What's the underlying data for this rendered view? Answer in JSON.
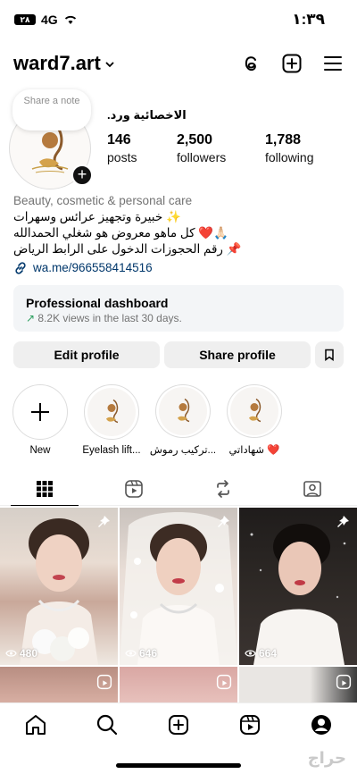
{
  "status": {
    "battery": "٢٨",
    "network": "4G",
    "time": "١:٣٩"
  },
  "header": {
    "username": "ward7.art",
    "icons": [
      "threads-icon",
      "create-icon",
      "menu-icon"
    ]
  },
  "profile": {
    "note_placeholder": "Share a note",
    "display_name": "الاخصائية ورد.",
    "stats": [
      {
        "value": "146",
        "label": "posts"
      },
      {
        "value": "2,500",
        "label": "followers"
      },
      {
        "value": "1,788",
        "label": "following"
      }
    ],
    "category": "Beauty, cosmetic & personal care",
    "bio_lines": [
      "خبيرة وتجهيز عرائس وسهرات ✨",
      "كل ماهو معروض هو شغلي الحمدالله ❤️🙏🏻",
      "رقم الحجوزات الدخول على الرابط الرياض 📌"
    ],
    "link": "wa.me/966558414516"
  },
  "dashboard": {
    "title": "Professional dashboard",
    "subtitle": "8.2K views in the last 30 days."
  },
  "actions": {
    "edit": "Edit profile",
    "share": "Share profile"
  },
  "highlights": [
    {
      "label": "New"
    },
    {
      "label": "Eyelash lift..."
    },
    {
      "label": "تركيب رموش..."
    },
    {
      "label": "شهاداتي ❤️"
    }
  ],
  "posts": [
    {
      "views": "480",
      "pinned": true
    },
    {
      "views": "646",
      "pinned": true
    },
    {
      "views": "664",
      "pinned": true
    }
  ],
  "watermark": "حراج"
}
